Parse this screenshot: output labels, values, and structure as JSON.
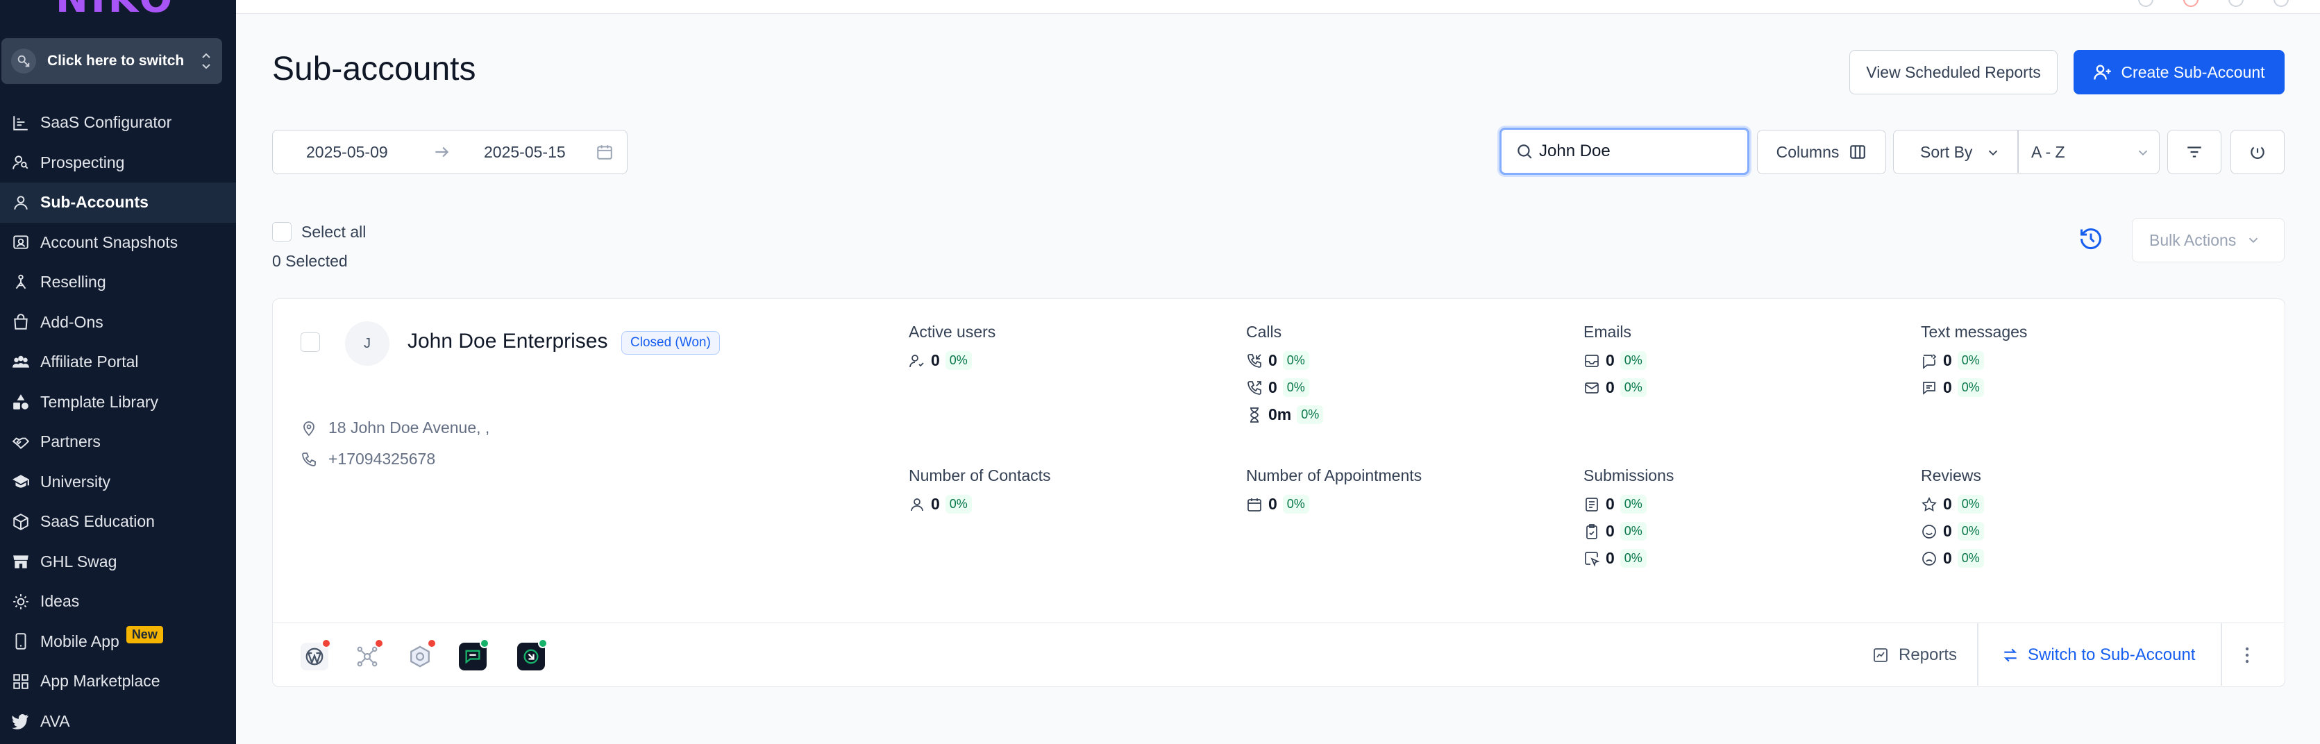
{
  "sidebar": {
    "logo": "NIKO",
    "switcher_label": "Click here to switch",
    "items": [
      {
        "label": "SaaS Configurator",
        "icon": "chart-bars-icon"
      },
      {
        "label": "Prospecting",
        "icon": "user-search-icon"
      },
      {
        "label": "Sub-Accounts",
        "icon": "user-icon",
        "active": true
      },
      {
        "label": "Account Snapshots",
        "icon": "snapshot-icon"
      },
      {
        "label": "Reselling",
        "icon": "reselling-icon"
      },
      {
        "label": "Add-Ons",
        "icon": "bag-icon"
      },
      {
        "label": "Affiliate Portal",
        "icon": "users-icon"
      },
      {
        "label": "Template Library",
        "icon": "shapes-icon"
      },
      {
        "label": "Partners",
        "icon": "handshake-icon"
      },
      {
        "label": "University",
        "icon": "graduation-cap-icon"
      },
      {
        "label": "SaaS Education",
        "icon": "package-icon"
      },
      {
        "label": "GHL Swag",
        "icon": "store-icon"
      },
      {
        "label": "Ideas",
        "icon": "lightbulb-icon"
      },
      {
        "label": "Mobile App",
        "icon": "mobile-icon",
        "badge": "New"
      },
      {
        "label": "App Marketplace",
        "icon": "grid-icon"
      },
      {
        "label": "AVA",
        "icon": "bird-icon"
      }
    ]
  },
  "header": {
    "title": "Sub-accounts",
    "view_scheduled_reports": "View Scheduled Reports",
    "create_sub_account": "Create Sub-Account"
  },
  "filters": {
    "date_from": "2025-05-09",
    "date_to": "2025-05-15",
    "search_value": "John Doe",
    "columns_label": "Columns",
    "sort_by_label": "Sort By",
    "sort_value": "A - Z"
  },
  "selection": {
    "select_all_label": "Select all",
    "selected_count": "0 Selected",
    "bulk_actions_label": "Bulk Actions"
  },
  "account": {
    "avatar_initial": "J",
    "name": "John Doe Enterprises",
    "status": "Closed (Won)",
    "address": "18 John Doe Avenue, ,",
    "phone": "+17094325678",
    "metrics": {
      "active_users": {
        "title": "Active users",
        "rows": [
          {
            "icon": "user-check-icon",
            "value": "0",
            "pct": "0%"
          }
        ]
      },
      "calls": {
        "title": "Calls",
        "rows": [
          {
            "icon": "phone-incoming-icon",
            "value": "0",
            "pct": "0%"
          },
          {
            "icon": "phone-outgoing-icon",
            "value": "0",
            "pct": "0%"
          },
          {
            "icon": "hourglass-icon",
            "value": "0m",
            "pct": "0%"
          }
        ]
      },
      "emails": {
        "title": "Emails",
        "rows": [
          {
            "icon": "inbox-icon",
            "value": "0",
            "pct": "0%"
          },
          {
            "icon": "mail-icon",
            "value": "0",
            "pct": "0%"
          }
        ]
      },
      "text_messages": {
        "title": "Text messages",
        "rows": [
          {
            "icon": "message-in-icon",
            "value": "0",
            "pct": "0%"
          },
          {
            "icon": "message-out-icon",
            "value": "0",
            "pct": "0%"
          }
        ]
      },
      "contacts": {
        "title": "Number of Contacts",
        "rows": [
          {
            "icon": "user-icon",
            "value": "0",
            "pct": "0%"
          }
        ]
      },
      "appointments": {
        "title": "Number of Appointments",
        "rows": [
          {
            "icon": "calendar-icon",
            "value": "0",
            "pct": "0%"
          }
        ]
      },
      "submissions": {
        "title": "Submissions",
        "rows": [
          {
            "icon": "form-icon",
            "value": "0",
            "pct": "0%"
          },
          {
            "icon": "clipboard-check-icon",
            "value": "0",
            "pct": "0%"
          },
          {
            "icon": "cursor-click-icon",
            "value": "0",
            "pct": "0%"
          }
        ]
      },
      "reviews": {
        "title": "Reviews",
        "rows": [
          {
            "icon": "star-icon",
            "value": "0",
            "pct": "0%"
          },
          {
            "icon": "smile-icon",
            "value": "0",
            "pct": "0%"
          },
          {
            "icon": "frown-icon",
            "value": "0",
            "pct": "0%"
          }
        ]
      }
    },
    "footer": {
      "reports_label": "Reports",
      "switch_label": "Switch to Sub-Account"
    }
  },
  "colors": {
    "primary": "#155eef",
    "sidebar_bg": "#0f1a2e",
    "success_bg": "#ecfdf3",
    "success_text": "#067647",
    "error_dot": "#f04438",
    "ok_dot": "#17b26a"
  }
}
